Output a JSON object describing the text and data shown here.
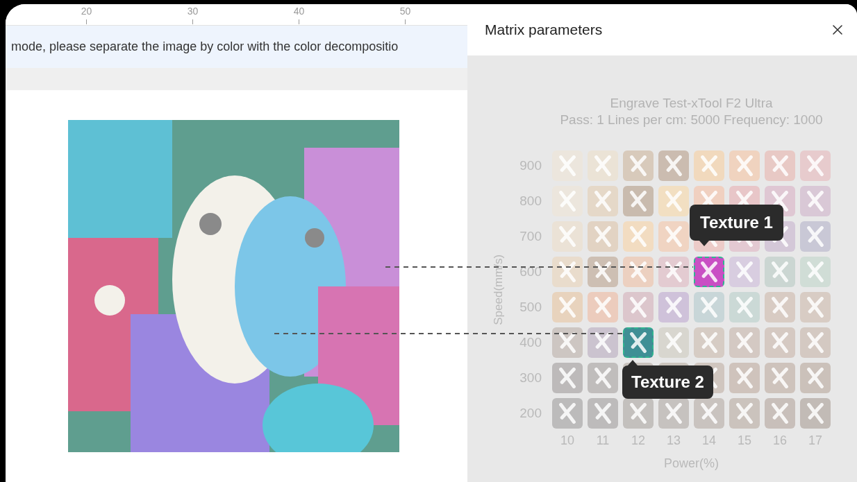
{
  "ruler": {
    "ticks": [
      "20",
      "30",
      "40",
      "50"
    ]
  },
  "banner": {
    "text": "mode, please separate the image by color with the color decompositio"
  },
  "panel": {
    "title": "Matrix parameters",
    "heading": "Engrave Test-xTool F2 Ultra",
    "subheading": "Pass: 1 Lines per cm: 5000 Frequency: 1000",
    "ylabel": "Speed(mm/s)",
    "xlabel": "Power(%)",
    "tooltips": [
      "Texture 1",
      "Texture 2"
    ],
    "columns": [
      "10",
      "11",
      "12",
      "13",
      "14",
      "15",
      "16",
      "17"
    ],
    "rows": [
      {
        "speed": "900",
        "cells": [
          {
            "color": "#ece6dd",
            "selected": false
          },
          {
            "color": "#ebe3d6",
            "selected": false
          },
          {
            "color": "#d8cabb",
            "selected": false
          },
          {
            "color": "#cbbcb0",
            "selected": false
          },
          {
            "color": "#f1d9bd",
            "selected": false
          },
          {
            "color": "#f0d3bf",
            "selected": false
          },
          {
            "color": "#e8c9c5",
            "selected": false
          },
          {
            "color": "#e7cbcd",
            "selected": false
          }
        ]
      },
      {
        "speed": "800",
        "cells": [
          {
            "color": "#ece6dd",
            "selected": false
          },
          {
            "color": "#e5d8c8",
            "selected": false
          },
          {
            "color": "#c9bbae",
            "selected": false
          },
          {
            "color": "#f2dfc2",
            "selected": false
          },
          {
            "color": "#f0d0c0",
            "selected": false
          },
          {
            "color": "#e8c6c8",
            "selected": false
          },
          {
            "color": "#dfc7d3",
            "selected": false
          },
          {
            "color": "#d9c8d6",
            "selected": false
          }
        ]
      },
      {
        "speed": "700",
        "cells": [
          {
            "color": "#ebe2d6",
            "selected": false
          },
          {
            "color": "#e2d3c3",
            "selected": false
          },
          {
            "color": "#f2dcc1",
            "selected": false
          },
          {
            "color": "#f0d4c2",
            "selected": false
          },
          {
            "color": "#eccbc8",
            "selected": false
          },
          {
            "color": "#e3c9d2",
            "selected": false
          },
          {
            "color": "#d4c8d8",
            "selected": false
          },
          {
            "color": "#c9c8d6",
            "selected": false
          }
        ]
      },
      {
        "speed": "600",
        "cells": [
          {
            "color": "#e9dccc",
            "selected": false
          },
          {
            "color": "#cdbfb3",
            "selected": false
          },
          {
            "color": "#ecd0c0",
            "selected": false
          },
          {
            "color": "#e3cbd1",
            "selected": false
          },
          {
            "color": "#c94fc4",
            "selected": true
          },
          {
            "color": "#d8cde0",
            "selected": false
          },
          {
            "color": "#cbd6d2",
            "selected": false
          },
          {
            "color": "#d0ddd6",
            "selected": false
          }
        ]
      },
      {
        "speed": "500",
        "cells": [
          {
            "color": "#e8d3bd",
            "selected": false
          },
          {
            "color": "#ecccbd",
            "selected": false
          },
          {
            "color": "#dcc6cc",
            "selected": false
          },
          {
            "color": "#cfc2da",
            "selected": false
          },
          {
            "color": "#c8d6d8",
            "selected": false
          },
          {
            "color": "#cbd9d6",
            "selected": false
          },
          {
            "color": "#d8cbc3",
            "selected": false
          },
          {
            "color": "#d8ccc4",
            "selected": false
          }
        ]
      },
      {
        "speed": "400",
        "cells": [
          {
            "color": "#cdc6c2",
            "selected": false
          },
          {
            "color": "#cbc3cf",
            "selected": false
          },
          {
            "color": "#3f8f95",
            "selected": true
          },
          {
            "color": "#d8d6cf",
            "selected": false
          },
          {
            "color": "#d6ccc4",
            "selected": false
          },
          {
            "color": "#d4c9c3",
            "selected": false
          },
          {
            "color": "#d5c9c2",
            "selected": false
          },
          {
            "color": "#d4c9c2",
            "selected": false
          }
        ]
      },
      {
        "speed": "300",
        "cells": [
          {
            "color": "#bdbaba",
            "selected": false
          },
          {
            "color": "#c0bdbc",
            "selected": false
          },
          {
            "color": "#c7c1bc",
            "selected": false
          },
          {
            "color": "#cbc4bd",
            "selected": false
          },
          {
            "color": "#d0c6bf",
            "selected": false
          },
          {
            "color": "#cfc3bc",
            "selected": false
          },
          {
            "color": "#cec3bc",
            "selected": false
          },
          {
            "color": "#cbc1ba",
            "selected": false
          }
        ]
      },
      {
        "speed": "200",
        "cells": [
          {
            "color": "#bcbbbb",
            "selected": false
          },
          {
            "color": "#bdbbbb",
            "selected": false
          },
          {
            "color": "#c3c0bd",
            "selected": false
          },
          {
            "color": "#c6c2bf",
            "selected": false
          },
          {
            "color": "#c9c3bf",
            "selected": false
          },
          {
            "color": "#cbc3bd",
            "selected": false
          },
          {
            "color": "#c8bfba",
            "selected": false
          },
          {
            "color": "#c2bbb6",
            "selected": false
          }
        ]
      }
    ]
  }
}
